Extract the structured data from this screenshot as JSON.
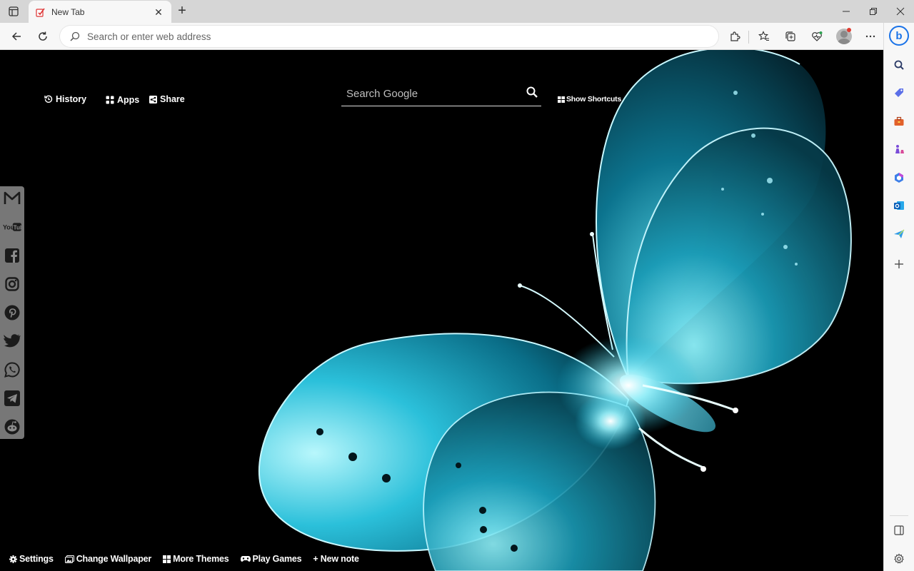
{
  "browser": {
    "tab": {
      "title": "New Tab",
      "close_glyph": "✕",
      "favicon": "newtab-favicon-icon"
    },
    "new_tab_glyph": "+",
    "address_bar": {
      "placeholder": "Search or enter web address",
      "value": ""
    },
    "colors": {
      "tabstrip": "#d6d6d6",
      "toolbar": "#f7f7f7",
      "accent": "#1a73e8"
    }
  },
  "edge_sidebar": {
    "items": [
      "search-icon",
      "shopping-tag-icon",
      "tools-briefcase-icon",
      "games-chess-icon",
      "microsoft-365-icon",
      "outlook-icon",
      "drop-send-icon",
      "add-icon"
    ],
    "bottom_items": [
      "split-screen-icon",
      "settings-gear-icon"
    ]
  },
  "newtab": {
    "top_links": {
      "history": "History",
      "apps": "Apps",
      "share": "Share"
    },
    "search": {
      "placeholder": "Search Google"
    },
    "show_shortcuts": "Show Shortcuts",
    "social": [
      "gmail-icon",
      "youtube-icon",
      "facebook-icon",
      "instagram-icon",
      "pinterest-icon",
      "twitter-icon",
      "whatsapp-icon",
      "telegram-icon",
      "reddit-icon"
    ],
    "bottom_links": {
      "settings": "Settings",
      "change_wallpaper": "Change Wallpaper",
      "more_themes": "More Themes",
      "play_games": "Play Games",
      "new_note": "+ New note"
    },
    "wallpaper": {
      "subject": "glowing-blue-butterfly",
      "colors": [
        "#000000",
        "#3fd0e8",
        "#0a8fb0"
      ]
    }
  }
}
